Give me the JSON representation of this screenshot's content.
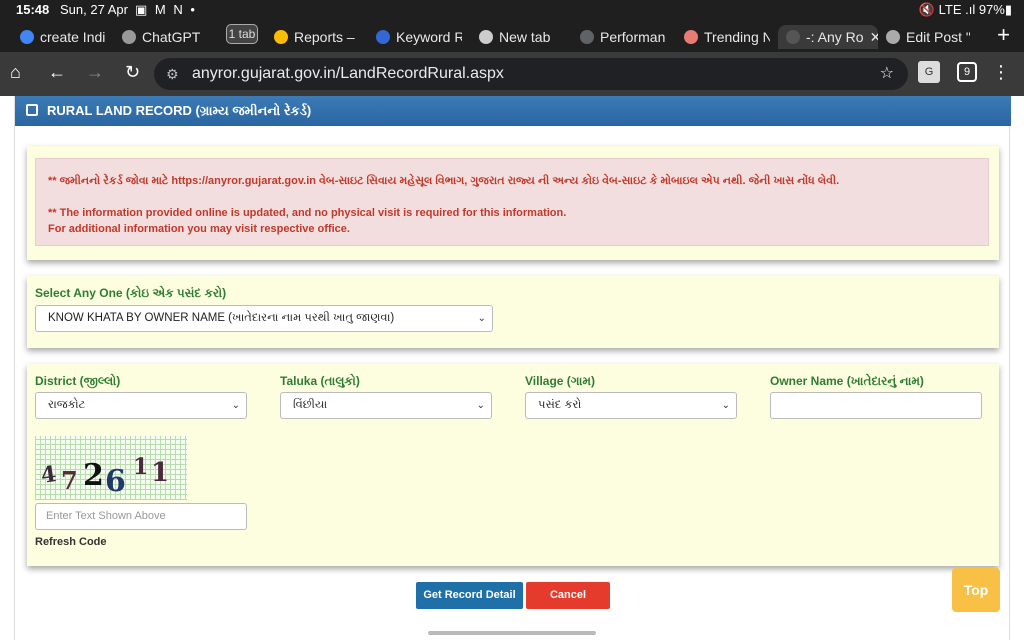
{
  "status": {
    "time": "15:48",
    "date": "Sun, 27 Apr",
    "icons": "▣ M N •",
    "right": "🔇 LTE .ıl 97%▮"
  },
  "tabs": [
    {
      "label": "create India",
      "color": "#4285f4"
    },
    {
      "label": "ChatGPT",
      "color": "#999999"
    },
    {
      "label": "Reports – G",
      "color": "#fbbc04"
    },
    {
      "label": "Keyword Re",
      "color": "#3367d6"
    },
    {
      "label": "New tab",
      "color": "#cccccc"
    },
    {
      "label": "Performanc",
      "color": "#5f6368"
    },
    {
      "label": "Trending N",
      "color": "#e67c73"
    },
    {
      "label": "-: Any Ro",
      "color": "#555555"
    },
    {
      "label": "Edit Post \"F",
      "color": "#aaaaaa"
    }
  ],
  "tab_count": "1 tab",
  "tab_close": "✕",
  "new_tab": "+",
  "url": "anyror.gujarat.gov.in/LandRecordRural.aspx",
  "tab_switch_count": "9",
  "translate_label": "G",
  "header_title": "RURAL LAND RECORD (ગ્રામ્ય જમીનનો રેકર્ડ)",
  "notice": {
    "line1": "** જમીનનો રેકર્ડ જોવા માટે https://anyror.gujarat.gov.in વેબ-સાઇટ સિવાય મહેસૂલ વિભાગ, ગુજરાત રાજ્ય ની અન્ય કોઇ વેબ-સાઇટ કે મોબાઇલ એપ નથી. જેની ખાસ નોંધ લેવી.",
    "line2": "** The information provided online is updated, and no physical visit is required for this information.",
    "line3": "For additional information you may visit respective office."
  },
  "select_any": {
    "label": "Select Any One (કોઇ એક પસંદ કરો)",
    "value": "KNOW KHATA BY OWNER NAME (ખાતેદારના નામ પરથી ખાતુ જાણવા)"
  },
  "district": {
    "label": "District (જીલ્લો)",
    "value": "રાજકોટ"
  },
  "taluka": {
    "label": "Taluka (તાલુકો)",
    "value": "વિંછીયા"
  },
  "village": {
    "label": "Village (ગામ)",
    "value": "પસંદ કરો"
  },
  "owner": {
    "label": "Owner Name (ખાતેદારનું નામ)",
    "value": ""
  },
  "captcha_text": [
    "4",
    "7",
    "2",
    "6",
    "1",
    "1"
  ],
  "captcha_placeholder": "Enter Text Shown Above",
  "refresh_label": "Refresh Code",
  "buttons": {
    "get": "Get Record Detail",
    "cancel": "Cancel",
    "top": "Top"
  },
  "colors": {
    "header": "#2a66a1",
    "panel": "#fdfde0",
    "label": "#2e7d32",
    "get_button": "#1f6fa8",
    "cancel_button": "#e53b2c",
    "top_button": "#f8c045"
  }
}
